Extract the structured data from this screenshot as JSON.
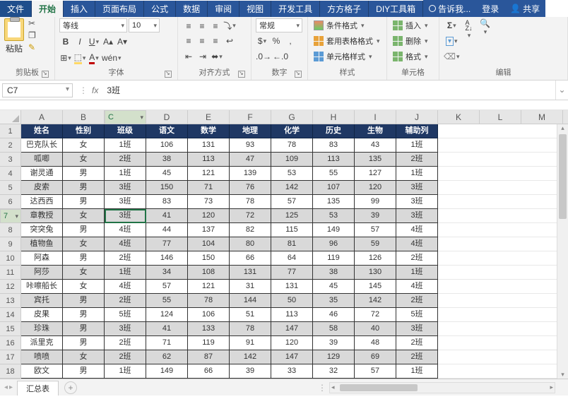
{
  "tabs": {
    "file": "文件",
    "home": "开始",
    "insert": "插入",
    "layout": "页面布局",
    "formulas": "公式",
    "data": "数据",
    "review": "审阅",
    "view": "视图",
    "dev": "开发工具",
    "addon": "方方格子",
    "diy": "DIY工具箱",
    "tell": "告诉我...",
    "login": "登录",
    "share": "共享"
  },
  "ribbon": {
    "clipboard": {
      "label": "剪贴板",
      "paste": "粘贴"
    },
    "font": {
      "label": "字体",
      "name": "等线",
      "size": "10",
      "wen": "wén"
    },
    "align": {
      "label": "对齐方式"
    },
    "number": {
      "label": "数字",
      "format": "常规"
    },
    "styles": {
      "label": "样式",
      "cond": "条件格式",
      "table": "套用表格格式",
      "cell": "单元格样式"
    },
    "cells": {
      "label": "单元格",
      "insert": "插入",
      "delete": "删除",
      "format": "格式"
    },
    "edit": {
      "label": "编辑"
    }
  },
  "fbar": {
    "name": "C7",
    "formula": "3班"
  },
  "columns": [
    "A",
    "B",
    "C",
    "D",
    "E",
    "F",
    "G",
    "H",
    "I",
    "J",
    "K",
    "L",
    "M"
  ],
  "headers": [
    "姓名",
    "性别",
    "班级",
    "语文",
    "数学",
    "地理",
    "化学",
    "历史",
    "生物",
    "辅助列"
  ],
  "rows": [
    [
      "巴克队长",
      "女",
      "1班",
      "106",
      "131",
      "93",
      "78",
      "83",
      "43",
      "1班"
    ],
    [
      "呱唧",
      "女",
      "2班",
      "38",
      "113",
      "47",
      "109",
      "113",
      "135",
      "2班"
    ],
    [
      "谢灵通",
      "男",
      "1班",
      "45",
      "121",
      "139",
      "53",
      "55",
      "127",
      "1班"
    ],
    [
      "皮索",
      "男",
      "3班",
      "150",
      "71",
      "76",
      "142",
      "107",
      "120",
      "3班"
    ],
    [
      "达西西",
      "男",
      "3班",
      "83",
      "73",
      "78",
      "57",
      "135",
      "99",
      "3班"
    ],
    [
      "章教授",
      "女",
      "3班",
      "41",
      "120",
      "72",
      "125",
      "53",
      "39",
      "3班"
    ],
    [
      "突突兔",
      "男",
      "4班",
      "44",
      "137",
      "82",
      "115",
      "149",
      "57",
      "4班"
    ],
    [
      "植物鱼",
      "女",
      "4班",
      "77",
      "104",
      "80",
      "81",
      "96",
      "59",
      "4班"
    ],
    [
      "阿森",
      "男",
      "2班",
      "146",
      "150",
      "66",
      "64",
      "119",
      "126",
      "2班"
    ],
    [
      "阿莎",
      "女",
      "1班",
      "34",
      "108",
      "131",
      "77",
      "38",
      "130",
      "1班"
    ],
    [
      "咔嚓船长",
      "女",
      "4班",
      "57",
      "121",
      "31",
      "131",
      "45",
      "145",
      "4班"
    ],
    [
      "宾托",
      "男",
      "2班",
      "55",
      "78",
      "144",
      "50",
      "35",
      "142",
      "2班"
    ],
    [
      "皮果",
      "男",
      "5班",
      "124",
      "106",
      "51",
      "113",
      "46",
      "72",
      "5班"
    ],
    [
      "珍珠",
      "男",
      "3班",
      "41",
      "133",
      "78",
      "147",
      "58",
      "40",
      "3班"
    ],
    [
      "派里克",
      "男",
      "2班",
      "71",
      "119",
      "91",
      "120",
      "39",
      "48",
      "2班"
    ],
    [
      "喷喷",
      "女",
      "2班",
      "62",
      "87",
      "142",
      "147",
      "129",
      "69",
      "2班"
    ],
    [
      "欧文",
      "男",
      "1班",
      "149",
      "66",
      "39",
      "33",
      "32",
      "57",
      "1班"
    ]
  ],
  "sheet": {
    "name": "汇总表"
  },
  "activeCell": {
    "row": 7,
    "col": 2
  }
}
